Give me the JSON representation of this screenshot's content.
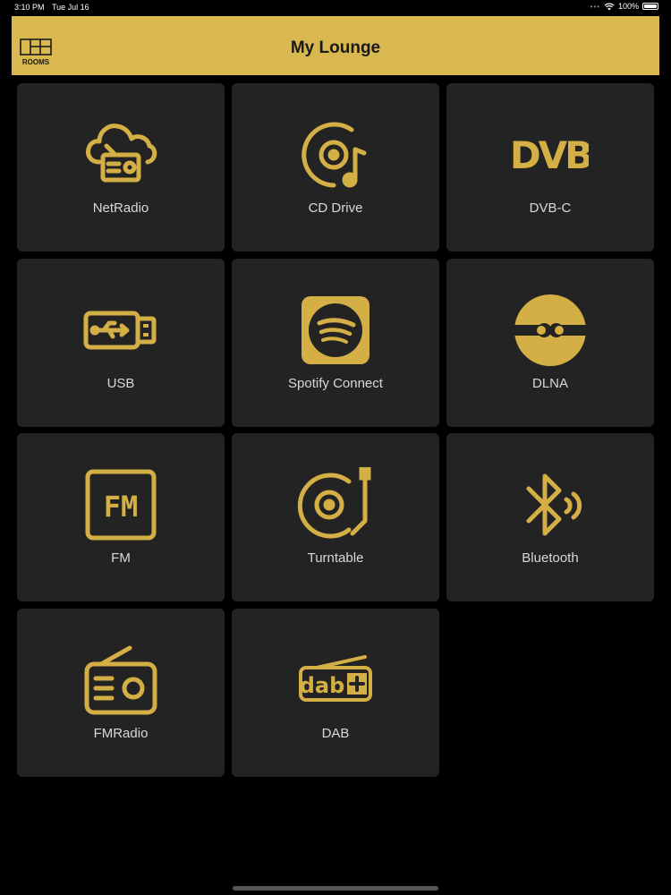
{
  "status_bar": {
    "time": "3:10 PM",
    "date": "Tue Jul 16",
    "battery": "100%"
  },
  "header": {
    "title": "My Lounge",
    "logo_text": "ROOMS",
    "background": "#d9b850"
  },
  "accent_color": "#d4af45",
  "tiles": [
    {
      "label": "NetRadio",
      "icon": "cloud-radio-icon"
    },
    {
      "label": "CD Drive",
      "icon": "cd-drive-icon"
    },
    {
      "label": "DVB-C",
      "icon": "dvb-icon"
    },
    {
      "label": "USB",
      "icon": "usb-icon"
    },
    {
      "label": "Spotify Connect",
      "icon": "spotify-icon"
    },
    {
      "label": "DLNA",
      "icon": "dlna-icon"
    },
    {
      "label": "FM",
      "icon": "fm-icon"
    },
    {
      "label": "Turntable",
      "icon": "turntable-icon"
    },
    {
      "label": "Bluetooth",
      "icon": "bluetooth-icon"
    },
    {
      "label": "FMRadio",
      "icon": "fm-radio-icon"
    },
    {
      "label": "DAB",
      "icon": "dab-icon"
    }
  ]
}
